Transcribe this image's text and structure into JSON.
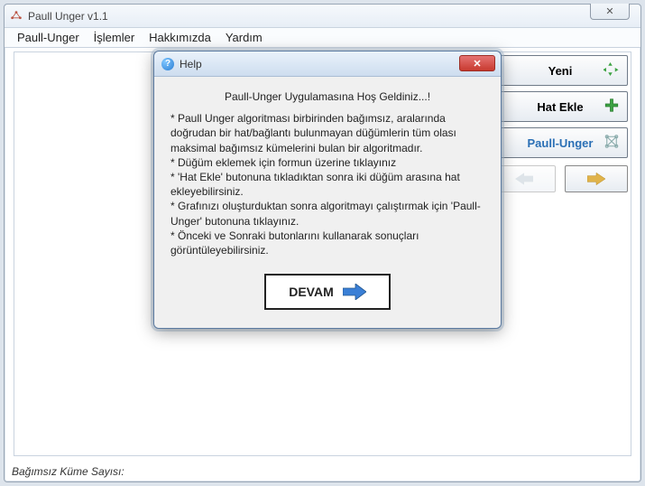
{
  "window": {
    "title": "Paull Unger v1.1",
    "close_glyph": "✕"
  },
  "menu": {
    "items": [
      "Paull-Unger",
      "İşlemler",
      "Hakkımızda",
      "Yardım"
    ]
  },
  "side": {
    "yeni": "Yeni",
    "hat_ekle": "Hat Ekle",
    "paull_unger": "Paull-Unger"
  },
  "statusbar": "Bağımsız Küme Sayısı:",
  "dialog": {
    "title": "Help",
    "welcome": "Paull-Unger Uygulamasına Hoş Geldiniz...!",
    "body": "* Paull Unger algoritması birbirinden bağımsız, aralarında doğrudan bir hat/bağlantı bulunmayan düğümlerin tüm olası maksimal bağımsız kümelerini bulan bir algoritmadır.\n* Düğüm eklemek için formun üzerine tıklayınız\n* 'Hat Ekle' butonuna tıkladıktan sonra iki düğüm arasına hat ekleyebilirsiniz.\n* Grafınızı oluşturduktan sonra algoritmayı çalıştırmak için 'Paull-Unger' butonuna tıklayınız.\n* Önceki ve Sonraki butonlarını kullanarak sonuçları görüntüleyebilirsiniz.",
    "continue": "DEVAM",
    "close_glyph": "✕"
  }
}
